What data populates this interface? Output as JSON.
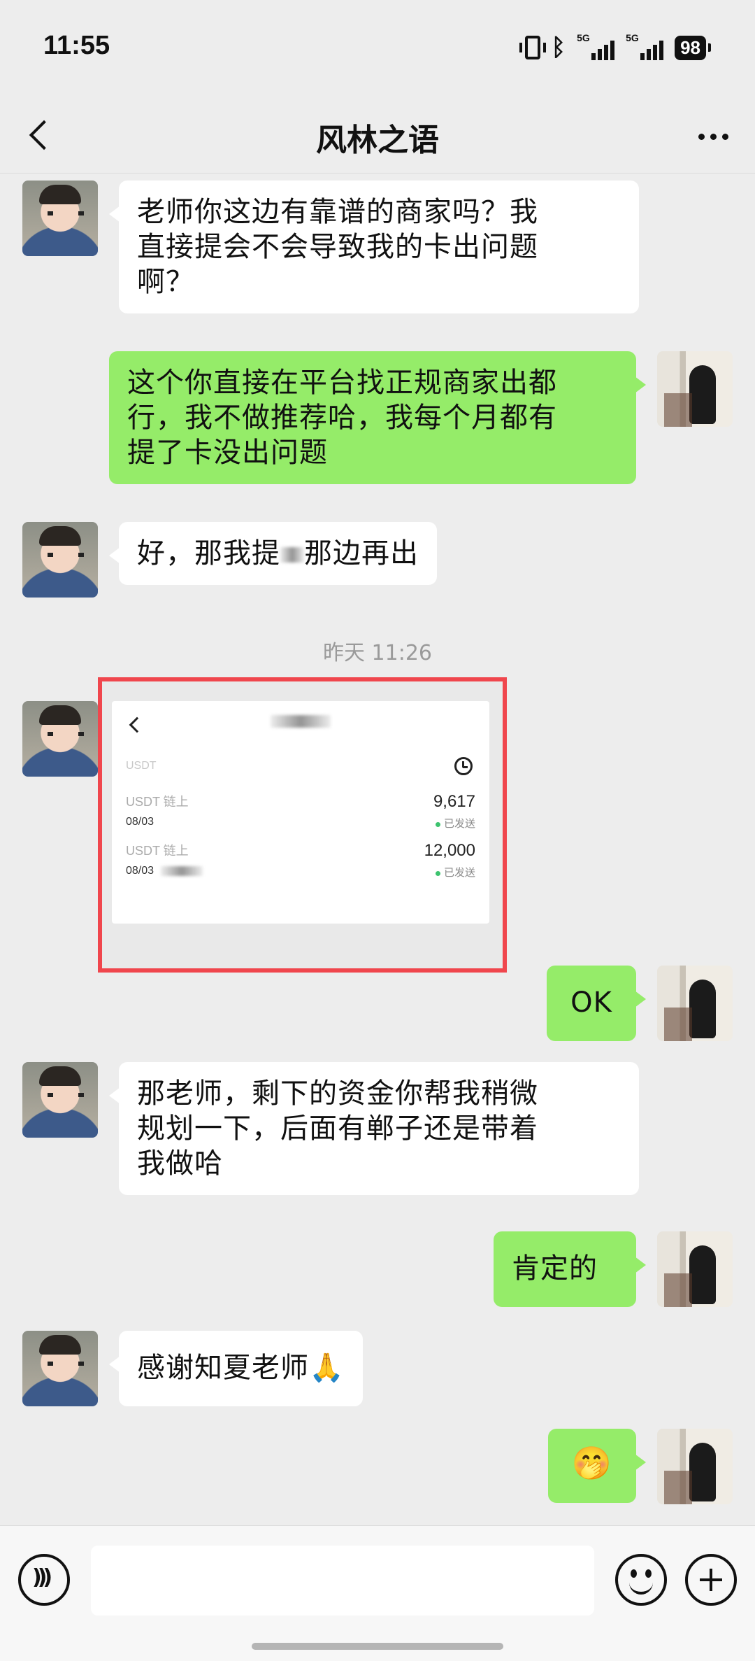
{
  "status_bar": {
    "time": "11:55",
    "net1": "5G",
    "net2": "5G",
    "battery": "98"
  },
  "header": {
    "title": "风林之语"
  },
  "messages": [
    {
      "side": "in",
      "lines": [
        "老师你这边有靠谱的商家吗？我",
        "直接提会不会导致我的卡出问题",
        "啊？"
      ]
    },
    {
      "side": "out",
      "lines": [
        "这个你直接在平台找正规商家出都",
        "行，我不做推荐哈，我每个月都有",
        "提了卡没出问题"
      ]
    },
    {
      "side": "in",
      "text_a": "好，那我提",
      "text_b": "那边再出"
    },
    {
      "timestamp": "昨天 11:26"
    },
    {
      "side": "in",
      "type": "image",
      "screenshot": {
        "coin": "USDT",
        "records": [
          {
            "name": "USDT 链上",
            "date": "08/03",
            "amount": "9,617",
            "status": "已发送"
          },
          {
            "name": "USDT 链上",
            "date": "08/03",
            "amount": "12,000",
            "status": "已发送"
          }
        ]
      }
    },
    {
      "side": "out",
      "text": "OK"
    },
    {
      "side": "in",
      "lines": [
        "那老师，剩下的资金你帮我稍微",
        "规划一下，后面有郸子还是带着",
        "我做哈"
      ]
    },
    {
      "side": "out",
      "text": "肯定的"
    },
    {
      "side": "in",
      "text": "感谢知夏老师🙏"
    },
    {
      "side": "out",
      "text": "🤭"
    }
  ]
}
